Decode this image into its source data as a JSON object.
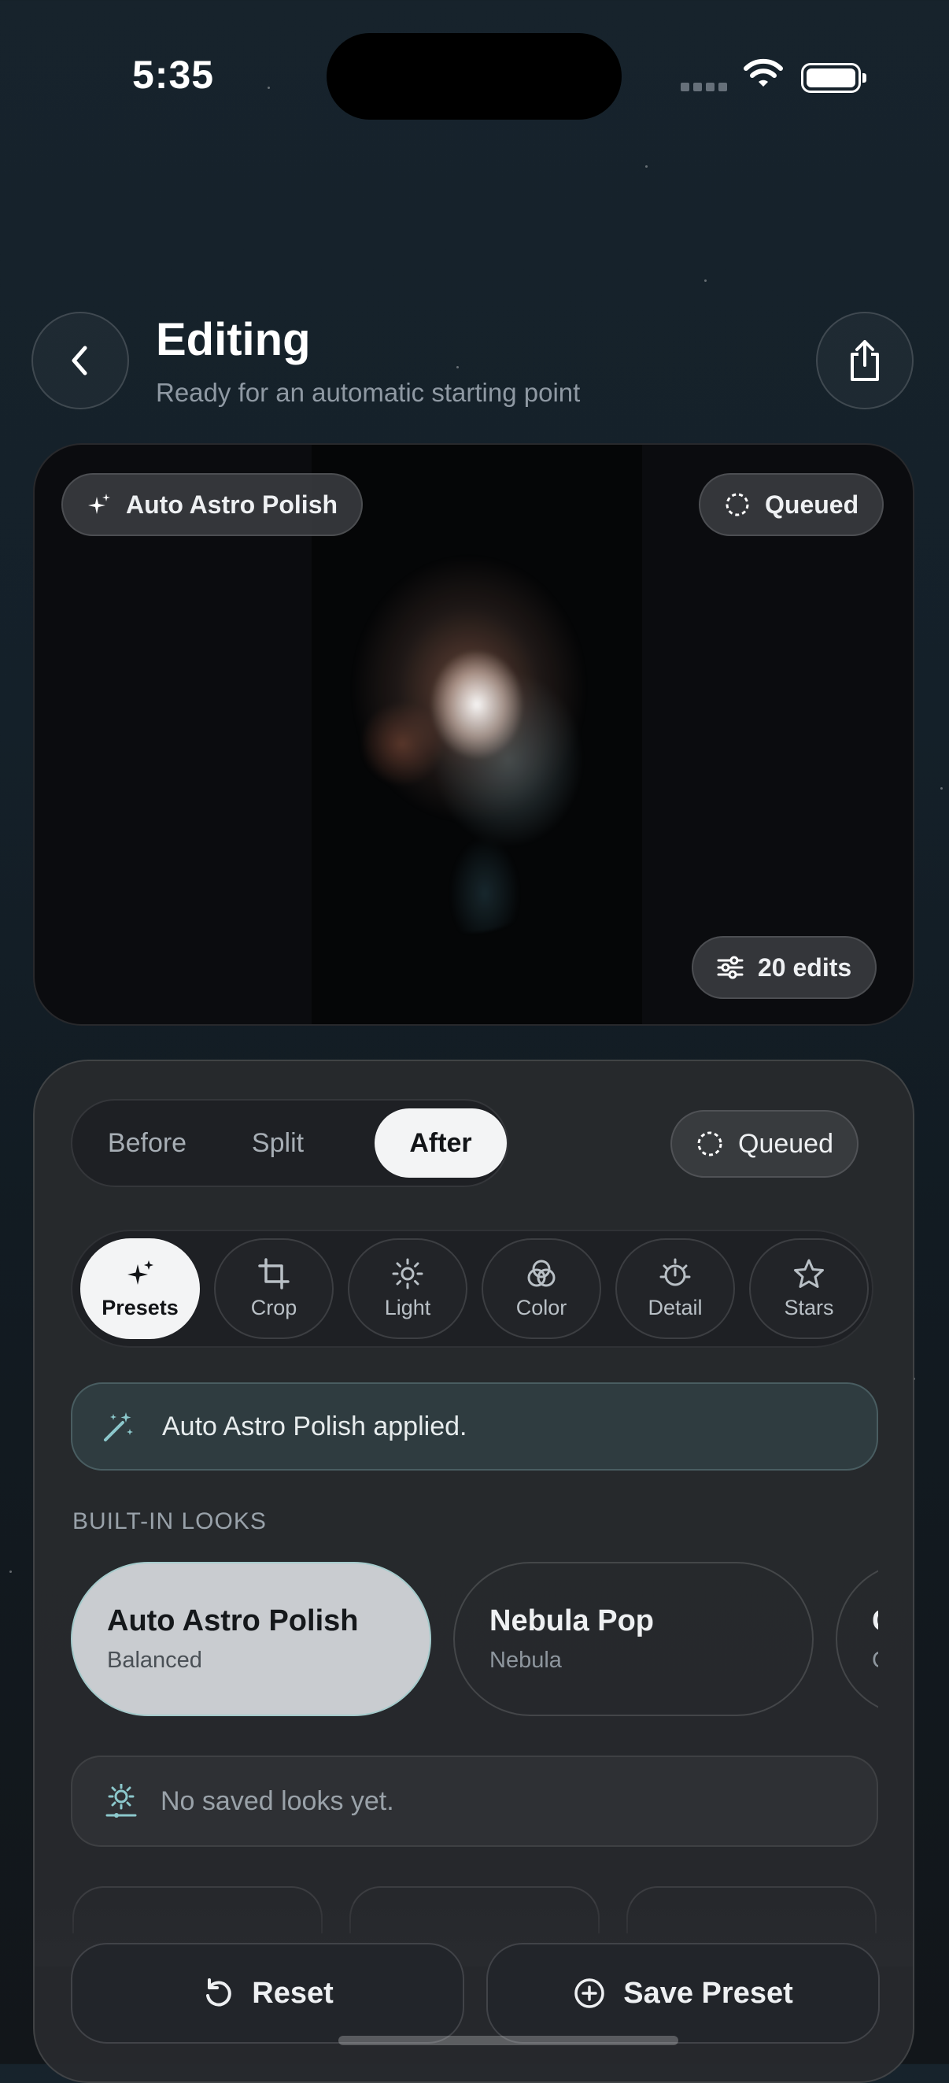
{
  "status_bar": {
    "time": "5:35"
  },
  "header": {
    "title": "Editing",
    "subtitle": "Ready for an automatic starting point"
  },
  "preview": {
    "preset_chip": "Auto Astro Polish",
    "status_chip": "Queued",
    "edits_chip": "20 edits"
  },
  "sheet": {
    "segments": [
      {
        "label": "Before",
        "active": false
      },
      {
        "label": "Split",
        "active": false
      },
      {
        "label": "After",
        "active": true
      }
    ],
    "status_chip": "Queued",
    "tools": [
      {
        "label": "Presets",
        "icon": "sparkles-icon",
        "active": true
      },
      {
        "label": "Crop",
        "icon": "crop-icon",
        "active": false
      },
      {
        "label": "Light",
        "icon": "sun-icon",
        "active": false
      },
      {
        "label": "Color",
        "icon": "color-circles-icon",
        "active": false
      },
      {
        "label": "Detail",
        "icon": "detail-dial-icon",
        "active": false
      },
      {
        "label": "Stars",
        "icon": "star-icon",
        "active": false
      }
    ],
    "banner": "Auto Astro Polish applied.",
    "section_title": "BUILT-IN LOOKS",
    "looks": [
      {
        "name": "Auto Astro Polish",
        "style": "Balanced",
        "selected": true
      },
      {
        "name": "Nebula Pop",
        "style": "Nebula",
        "selected": false
      },
      {
        "name": "C",
        "style": "C",
        "selected": false
      }
    ],
    "empty_saved": "No saved looks yet.",
    "reset_label": "Reset",
    "save_preset_label": "Save Preset"
  },
  "colors": {
    "accent_teal": "#8cc8cc",
    "active_pill": "#f3f4f5",
    "sheet_bg": "#28292e"
  }
}
